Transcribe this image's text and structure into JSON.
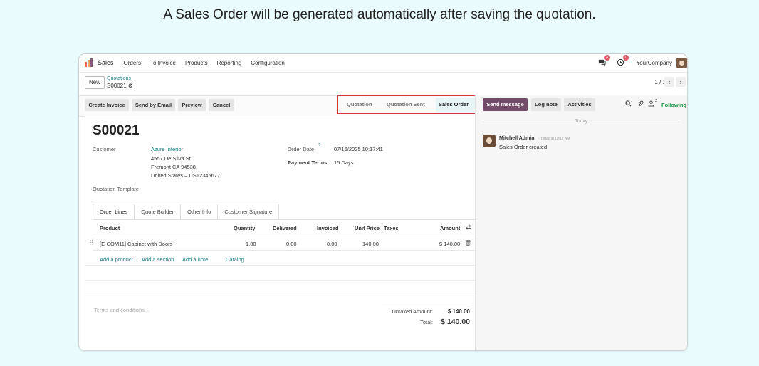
{
  "caption": "A Sales Order will be generated automatically after saving the quotation.",
  "nav": {
    "app_name": "Sales",
    "items": [
      "Orders",
      "To Invoice",
      "Products",
      "Reporting",
      "Configuration"
    ],
    "messages_badge": "4",
    "activities_badge": "1",
    "company": "YourCompany"
  },
  "breadcrumb": {
    "new_label": "New",
    "parent": "Quotations",
    "current": "S00021"
  },
  "pager": {
    "text": "1 / 1"
  },
  "actions": {
    "create_invoice": "Create Invoice",
    "send_by_email": "Send by Email",
    "preview": "Preview",
    "cancel": "Cancel"
  },
  "statusbar": {
    "steps": [
      "Quotation",
      "Quotation Sent",
      "Sales Order"
    ],
    "active": "Sales Order"
  },
  "order": {
    "name": "S00021",
    "customer_label": "Customer",
    "customer_name": "Azure Interior",
    "address": [
      "4557 De Silva St",
      "Fremont CA 94538",
      "United States – US12345677"
    ],
    "order_date_label": "Order Date",
    "order_date_help": "?",
    "order_date": "07/16/2025 10:17:41",
    "payment_terms_label": "Payment Terms",
    "payment_terms": "15 Days",
    "template_label": "Quotation Template"
  },
  "tabs": [
    "Order Lines",
    "Quote Builder",
    "Other Info",
    "Customer Signature"
  ],
  "table": {
    "headers": {
      "product": "Product",
      "quantity": "Quantity",
      "delivered": "Delivered",
      "invoiced": "Invoiced",
      "unit_price": "Unit Price",
      "taxes": "Taxes",
      "amount": "Amount"
    },
    "rows": [
      {
        "product": "[E-COM11] Cabinet with Doors",
        "quantity": "1.00",
        "delivered": "0.00",
        "invoiced": "0.00",
        "unit_price": "140.00",
        "taxes": "",
        "amount": "$ 140.00"
      }
    ],
    "add_product": "Add a product",
    "add_section": "Add a section",
    "add_note": "Add a note",
    "catalog": "Catalog"
  },
  "terms_placeholder": "Terms and conditions...",
  "totals": {
    "untaxed_label": "Untaxed Amount:",
    "untaxed_value": "$ 140.00",
    "total_label": "Total:",
    "total_value": "$ 140.00"
  },
  "chatter": {
    "send_message": "Send message",
    "log_note": "Log note",
    "activities": "Activities",
    "followers_count": "2",
    "following": "Following",
    "date_separator": "Today",
    "message_author": "Mitchell Admin",
    "message_time": "- Today at 10:17 AM",
    "message_body": "Sales Order created"
  },
  "colors": {
    "accent": "#1a7f86",
    "primary_button": "#714b67",
    "status_highlight": "#d23a3a",
    "following": "#1b9e4b"
  }
}
